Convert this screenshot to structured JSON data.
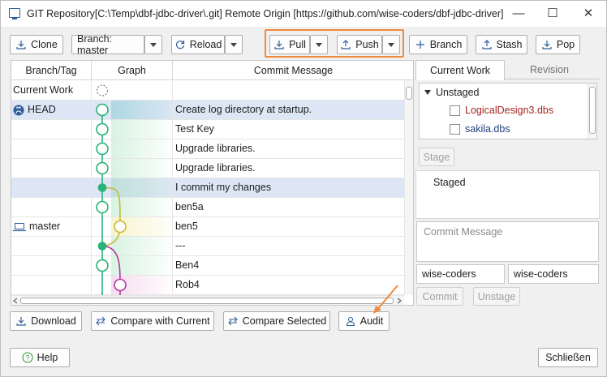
{
  "window": {
    "title": "GIT Repository[C:\\Temp\\dbf-jdbc-driver\\.git] Remote Origin [https://github.com/wise-coders/dbf-jdbc-driver]",
    "minimize_glyph": "—",
    "maximize_glyph": "☐",
    "close_glyph": "✕"
  },
  "toolbar": {
    "clone_label": "Clone",
    "branch_label": "Branch: master",
    "reload_label": "Reload",
    "pull_label": "Pull",
    "push_label": "Push",
    "new_branch_label": "Branch",
    "stash_label": "Stash",
    "pop_label": "Pop"
  },
  "history": {
    "columns": [
      "Branch/Tag",
      "Graph",
      "Commit Message"
    ],
    "rows": [
      {
        "branch": "Current Work",
        "branch_icon": "",
        "message": "",
        "selected": false
      },
      {
        "branch": "HEAD",
        "branch_icon": "github-icon",
        "message": "Create log directory at startup.",
        "selected": true
      },
      {
        "branch": "",
        "branch_icon": "",
        "message": "Test Key",
        "selected": false
      },
      {
        "branch": "",
        "branch_icon": "",
        "message": "Upgrade libraries.",
        "selected": false
      },
      {
        "branch": "",
        "branch_icon": "",
        "message": "Upgrade libraries.",
        "selected": false
      },
      {
        "branch": "",
        "branch_icon": "",
        "message": "I commit my changes",
        "selected": true
      },
      {
        "branch": "",
        "branch_icon": "",
        "message": "ben5a",
        "selected": false
      },
      {
        "branch": "master",
        "branch_icon": "laptop-icon",
        "message": "ben5",
        "selected": false
      },
      {
        "branch": "",
        "branch_icon": "",
        "message": "---",
        "selected": false
      },
      {
        "branch": "",
        "branch_icon": "",
        "message": "Ben4",
        "selected": false
      },
      {
        "branch": "",
        "branch_icon": "",
        "message": "Rob4",
        "selected": false
      }
    ]
  },
  "side_panel": {
    "tabs": [
      "Current Work",
      "Revision"
    ],
    "unstaged_label": "Unstaged",
    "unstaged_files": [
      {
        "name": "LogicalDesign3.dbs",
        "color": "#a5261f"
      },
      {
        "name": "sakila.dbs",
        "color": "#1f3f7a"
      }
    ],
    "stage_label": "Stage",
    "staged_label": "Staged",
    "commit_placeholder": "Commit Message",
    "author_name": "wise-coders",
    "author_email": "wise-coders",
    "commit_label": "Commit",
    "unstage_label": "Unstage"
  },
  "bottom_bar": {
    "download_label": "Download",
    "compare_current_label": "Compare with Current",
    "compare_selected_label": "Compare Selected",
    "audit_label": "Audit"
  },
  "footer": {
    "help_label": "Help",
    "close_label": "Schließen"
  },
  "colors": {
    "accent_highlight": "#f08a3c",
    "graph_main": "#27b37a",
    "graph_yellow": "#c8b93a",
    "graph_purple": "#b23aa0",
    "selection": "#dce6f4"
  }
}
